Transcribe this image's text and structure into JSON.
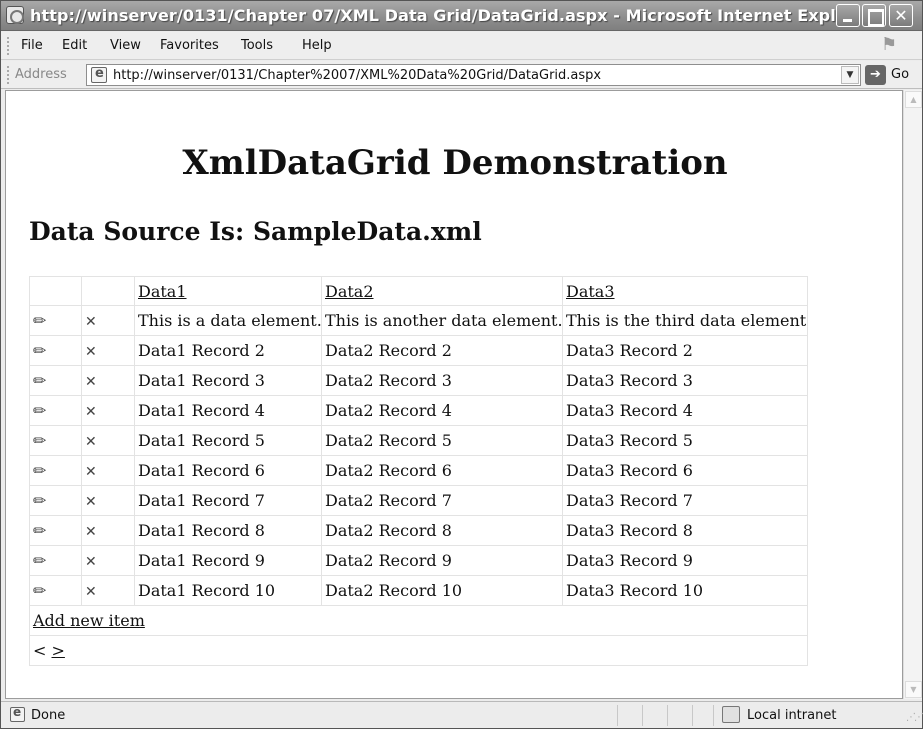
{
  "window": {
    "title": "http://winserver/0131/Chapter 07/XML Data Grid/DataGrid.aspx - Microsoft Internet Expl..."
  },
  "menu": {
    "items": [
      "File",
      "Edit",
      "View",
      "Favorites",
      "Tools",
      "Help"
    ]
  },
  "address": {
    "label": "Address",
    "url": "http://winserver/0131/Chapter%2007/XML%20Data%20Grid/DataGrid.aspx",
    "go_label": "Go"
  },
  "page": {
    "title": "XmlDataGrid Demonstration",
    "subtitle": "Data Source Is: SampleData.xml"
  },
  "grid": {
    "headers": [
      "Data1",
      "Data2",
      "Data3"
    ],
    "rows": [
      [
        "This is a data element.",
        "This is another data element.",
        "This is the third data element."
      ],
      [
        "Data1 Record 2",
        "Data2 Record 2",
        "Data3 Record 2"
      ],
      [
        "Data1 Record 3",
        "Data2 Record 3",
        "Data3 Record 3"
      ],
      [
        "Data1 Record 4",
        "Data2 Record 4",
        "Data3 Record 4"
      ],
      [
        "Data1 Record 5",
        "Data2 Record 5",
        "Data3 Record 5"
      ],
      [
        "Data1 Record 6",
        "Data2 Record 6",
        "Data3 Record 6"
      ],
      [
        "Data1 Record 7",
        "Data2 Record 7",
        "Data3 Record 7"
      ],
      [
        "Data1 Record 8",
        "Data2 Record 8",
        "Data3 Record 8"
      ],
      [
        "Data1 Record 9",
        "Data2 Record 9",
        "Data3 Record 9"
      ],
      [
        "Data1 Record 10",
        "Data2 Record 10",
        "Data3 Record 10"
      ]
    ],
    "edit_icon": "pencil-icon",
    "delete_icon": "close-icon",
    "edit_glyph": "✏",
    "delete_glyph": "✕",
    "add_new_label": "Add new item",
    "pager_prev": "<",
    "pager_next": ">"
  },
  "status": {
    "text": "Done",
    "zone": "Local intranet"
  }
}
